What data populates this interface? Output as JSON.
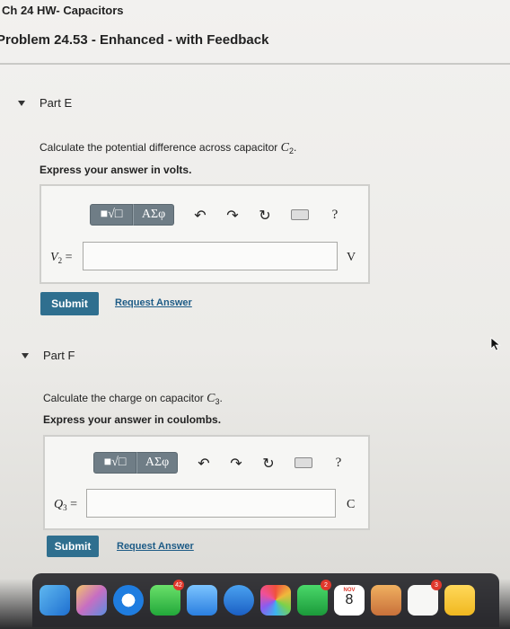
{
  "header": {
    "breadcrumb": "Ch 24 HW- Capacitors",
    "problem_title": "Problem 24.53 - Enhanced - with Feedback"
  },
  "toolbar": {
    "templates_label": "■√□",
    "greek_label": "ΑΣφ",
    "undo_glyph": "↶",
    "redo_glyph": "↷",
    "reset_glyph": "↻",
    "help_glyph": "?"
  },
  "parts": [
    {
      "label": "Part E",
      "question_prefix": "Calculate the potential difference across capacitor ",
      "question_var": "C",
      "question_sub": "2",
      "instruction": "Express your answer in volts.",
      "input_var": "V",
      "input_sub": "2",
      "equals": "=",
      "unit": "V",
      "submit_label": "Submit",
      "request_label": "Request Answer"
    },
    {
      "label": "Part F",
      "question_prefix": "Calculate the charge on capacitor ",
      "question_var": "C",
      "question_sub": "3",
      "instruction": "Express your answer in coulombs.",
      "input_var": "Q",
      "input_sub": "3",
      "equals": "=",
      "unit": "C",
      "submit_label": "Submit",
      "request_label": "Request Answer"
    }
  ],
  "dock": {
    "facetime_badge": "42",
    "mail_badge": "2",
    "calendar_month": "NOV",
    "calendar_day": "8",
    "reminders_badge": "3"
  },
  "colors": {
    "submit": "#2f6f8f",
    "toolbar_button": "#6f7d86",
    "link": "#1d5b86"
  }
}
